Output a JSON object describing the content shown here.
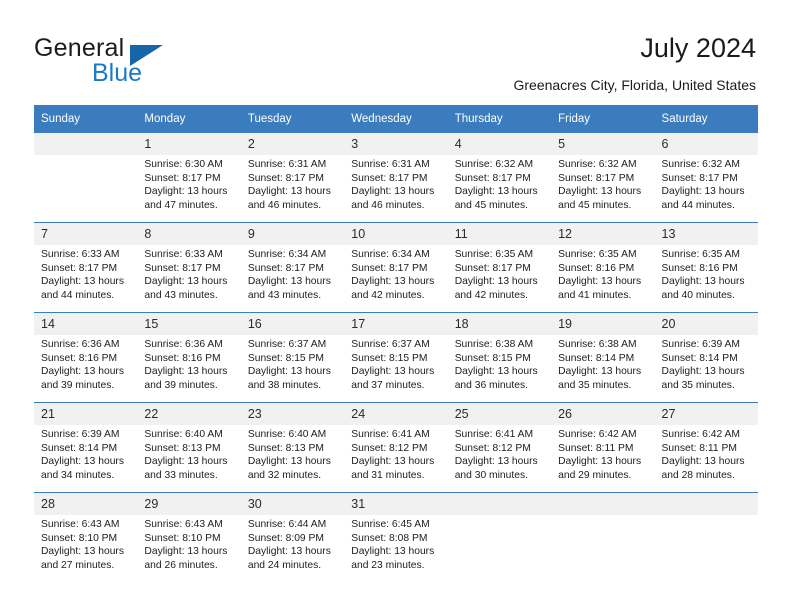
{
  "brand": {
    "name_part1": "General",
    "name_part2": "Blue",
    "accent_color": "#1b7ac4",
    "triangle_color": "#1565a8"
  },
  "header": {
    "title": "July 2024",
    "subtitle": "Greenacres City, Florida, United States"
  },
  "theme": {
    "header_row_bg": "#3a7cbe",
    "header_row_text": "#ffffff",
    "daynum_bg": "#f1f1f1",
    "separator": "#3a7cbe"
  },
  "weekday_headers": [
    "Sunday",
    "Monday",
    "Tuesday",
    "Wednesday",
    "Thursday",
    "Friday",
    "Saturday"
  ],
  "labels": {
    "sunrise": "Sunrise:",
    "sunset": "Sunset:",
    "daylight": "Daylight:"
  },
  "weeks": [
    [
      {
        "day": "",
        "sunrise": "",
        "sunset": "",
        "daylight1": "",
        "daylight2": "",
        "blank": true
      },
      {
        "day": "1",
        "sunrise": "Sunrise: 6:30 AM",
        "sunset": "Sunset: 8:17 PM",
        "daylight1": "Daylight: 13 hours",
        "daylight2": "and 47 minutes."
      },
      {
        "day": "2",
        "sunrise": "Sunrise: 6:31 AM",
        "sunset": "Sunset: 8:17 PM",
        "daylight1": "Daylight: 13 hours",
        "daylight2": "and 46 minutes."
      },
      {
        "day": "3",
        "sunrise": "Sunrise: 6:31 AM",
        "sunset": "Sunset: 8:17 PM",
        "daylight1": "Daylight: 13 hours",
        "daylight2": "and 46 minutes."
      },
      {
        "day": "4",
        "sunrise": "Sunrise: 6:32 AM",
        "sunset": "Sunset: 8:17 PM",
        "daylight1": "Daylight: 13 hours",
        "daylight2": "and 45 minutes."
      },
      {
        "day": "5",
        "sunrise": "Sunrise: 6:32 AM",
        "sunset": "Sunset: 8:17 PM",
        "daylight1": "Daylight: 13 hours",
        "daylight2": "and 45 minutes."
      },
      {
        "day": "6",
        "sunrise": "Sunrise: 6:32 AM",
        "sunset": "Sunset: 8:17 PM",
        "daylight1": "Daylight: 13 hours",
        "daylight2": "and 44 minutes."
      }
    ],
    [
      {
        "day": "7",
        "sunrise": "Sunrise: 6:33 AM",
        "sunset": "Sunset: 8:17 PM",
        "daylight1": "Daylight: 13 hours",
        "daylight2": "and 44 minutes."
      },
      {
        "day": "8",
        "sunrise": "Sunrise: 6:33 AM",
        "sunset": "Sunset: 8:17 PM",
        "daylight1": "Daylight: 13 hours",
        "daylight2": "and 43 minutes."
      },
      {
        "day": "9",
        "sunrise": "Sunrise: 6:34 AM",
        "sunset": "Sunset: 8:17 PM",
        "daylight1": "Daylight: 13 hours",
        "daylight2": "and 43 minutes."
      },
      {
        "day": "10",
        "sunrise": "Sunrise: 6:34 AM",
        "sunset": "Sunset: 8:17 PM",
        "daylight1": "Daylight: 13 hours",
        "daylight2": "and 42 minutes."
      },
      {
        "day": "11",
        "sunrise": "Sunrise: 6:35 AM",
        "sunset": "Sunset: 8:17 PM",
        "daylight1": "Daylight: 13 hours",
        "daylight2": "and 42 minutes."
      },
      {
        "day": "12",
        "sunrise": "Sunrise: 6:35 AM",
        "sunset": "Sunset: 8:16 PM",
        "daylight1": "Daylight: 13 hours",
        "daylight2": "and 41 minutes."
      },
      {
        "day": "13",
        "sunrise": "Sunrise: 6:35 AM",
        "sunset": "Sunset: 8:16 PM",
        "daylight1": "Daylight: 13 hours",
        "daylight2": "and 40 minutes."
      }
    ],
    [
      {
        "day": "14",
        "sunrise": "Sunrise: 6:36 AM",
        "sunset": "Sunset: 8:16 PM",
        "daylight1": "Daylight: 13 hours",
        "daylight2": "and 39 minutes."
      },
      {
        "day": "15",
        "sunrise": "Sunrise: 6:36 AM",
        "sunset": "Sunset: 8:16 PM",
        "daylight1": "Daylight: 13 hours",
        "daylight2": "and 39 minutes."
      },
      {
        "day": "16",
        "sunrise": "Sunrise: 6:37 AM",
        "sunset": "Sunset: 8:15 PM",
        "daylight1": "Daylight: 13 hours",
        "daylight2": "and 38 minutes."
      },
      {
        "day": "17",
        "sunrise": "Sunrise: 6:37 AM",
        "sunset": "Sunset: 8:15 PM",
        "daylight1": "Daylight: 13 hours",
        "daylight2": "and 37 minutes."
      },
      {
        "day": "18",
        "sunrise": "Sunrise: 6:38 AM",
        "sunset": "Sunset: 8:15 PM",
        "daylight1": "Daylight: 13 hours",
        "daylight2": "and 36 minutes."
      },
      {
        "day": "19",
        "sunrise": "Sunrise: 6:38 AM",
        "sunset": "Sunset: 8:14 PM",
        "daylight1": "Daylight: 13 hours",
        "daylight2": "and 35 minutes."
      },
      {
        "day": "20",
        "sunrise": "Sunrise: 6:39 AM",
        "sunset": "Sunset: 8:14 PM",
        "daylight1": "Daylight: 13 hours",
        "daylight2": "and 35 minutes."
      }
    ],
    [
      {
        "day": "21",
        "sunrise": "Sunrise: 6:39 AM",
        "sunset": "Sunset: 8:14 PM",
        "daylight1": "Daylight: 13 hours",
        "daylight2": "and 34 minutes."
      },
      {
        "day": "22",
        "sunrise": "Sunrise: 6:40 AM",
        "sunset": "Sunset: 8:13 PM",
        "daylight1": "Daylight: 13 hours",
        "daylight2": "and 33 minutes."
      },
      {
        "day": "23",
        "sunrise": "Sunrise: 6:40 AM",
        "sunset": "Sunset: 8:13 PM",
        "daylight1": "Daylight: 13 hours",
        "daylight2": "and 32 minutes."
      },
      {
        "day": "24",
        "sunrise": "Sunrise: 6:41 AM",
        "sunset": "Sunset: 8:12 PM",
        "daylight1": "Daylight: 13 hours",
        "daylight2": "and 31 minutes."
      },
      {
        "day": "25",
        "sunrise": "Sunrise: 6:41 AM",
        "sunset": "Sunset: 8:12 PM",
        "daylight1": "Daylight: 13 hours",
        "daylight2": "and 30 minutes."
      },
      {
        "day": "26",
        "sunrise": "Sunrise: 6:42 AM",
        "sunset": "Sunset: 8:11 PM",
        "daylight1": "Daylight: 13 hours",
        "daylight2": "and 29 minutes."
      },
      {
        "day": "27",
        "sunrise": "Sunrise: 6:42 AM",
        "sunset": "Sunset: 8:11 PM",
        "daylight1": "Daylight: 13 hours",
        "daylight2": "and 28 minutes."
      }
    ],
    [
      {
        "day": "28",
        "sunrise": "Sunrise: 6:43 AM",
        "sunset": "Sunset: 8:10 PM",
        "daylight1": "Daylight: 13 hours",
        "daylight2": "and 27 minutes."
      },
      {
        "day": "29",
        "sunrise": "Sunrise: 6:43 AM",
        "sunset": "Sunset: 8:10 PM",
        "daylight1": "Daylight: 13 hours",
        "daylight2": "and 26 minutes."
      },
      {
        "day": "30",
        "sunrise": "Sunrise: 6:44 AM",
        "sunset": "Sunset: 8:09 PM",
        "daylight1": "Daylight: 13 hours",
        "daylight2": "and 24 minutes."
      },
      {
        "day": "31",
        "sunrise": "Sunrise: 6:45 AM",
        "sunset": "Sunset: 8:08 PM",
        "daylight1": "Daylight: 13 hours",
        "daylight2": "and 23 minutes."
      },
      {
        "day": "",
        "sunrise": "",
        "sunset": "",
        "daylight1": "",
        "daylight2": "",
        "blank": true
      },
      {
        "day": "",
        "sunrise": "",
        "sunset": "",
        "daylight1": "",
        "daylight2": "",
        "blank": true
      },
      {
        "day": "",
        "sunrise": "",
        "sunset": "",
        "daylight1": "",
        "daylight2": "",
        "blank": true
      }
    ]
  ]
}
